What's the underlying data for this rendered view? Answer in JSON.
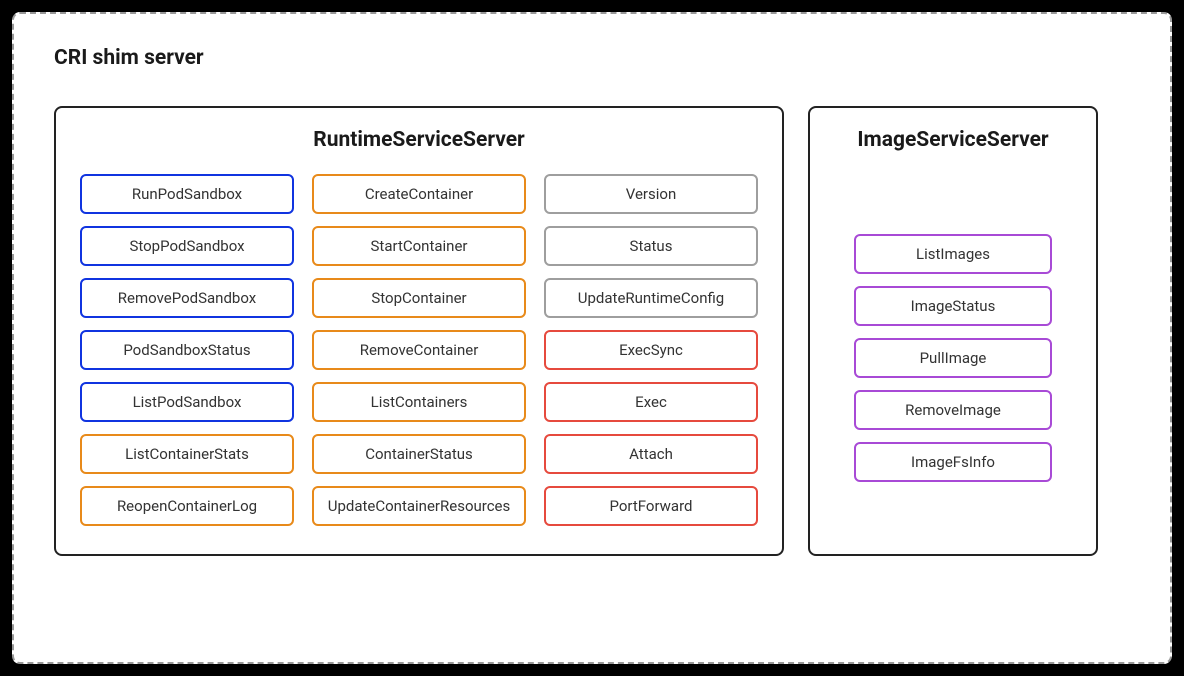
{
  "title": "CRI shim server",
  "colors": {
    "blue": "#1034e0",
    "orange": "#e88a1a",
    "gray": "#9e9e9e",
    "red": "#e64a3e",
    "purple": "#a84ad6"
  },
  "panels": {
    "runtime": {
      "title": "RuntimeServiceServer",
      "columns": [
        [
          {
            "label": "RunPodSandbox",
            "color": "blue"
          },
          {
            "label": "StopPodSandbox",
            "color": "blue"
          },
          {
            "label": "RemovePodSandbox",
            "color": "blue"
          },
          {
            "label": "PodSandboxStatus",
            "color": "blue"
          },
          {
            "label": "ListPodSandbox",
            "color": "blue"
          },
          {
            "label": "ListContainerStats",
            "color": "orange"
          },
          {
            "label": "ReopenContainerLog",
            "color": "orange"
          }
        ],
        [
          {
            "label": "CreateContainer",
            "color": "orange"
          },
          {
            "label": "StartContainer",
            "color": "orange"
          },
          {
            "label": "StopContainer",
            "color": "orange"
          },
          {
            "label": "RemoveContainer",
            "color": "orange"
          },
          {
            "label": "ListContainers",
            "color": "orange"
          },
          {
            "label": "ContainerStatus",
            "color": "orange"
          },
          {
            "label": "UpdateContainerResources",
            "color": "orange"
          }
        ],
        [
          {
            "label": "Version",
            "color": "gray"
          },
          {
            "label": "Status",
            "color": "gray"
          },
          {
            "label": "UpdateRuntimeConfig",
            "color": "gray"
          },
          {
            "label": "ExecSync",
            "color": "red"
          },
          {
            "label": "Exec",
            "color": "red"
          },
          {
            "label": "Attach",
            "color": "red"
          },
          {
            "label": "PortForward",
            "color": "red"
          }
        ]
      ]
    },
    "image": {
      "title": "ImageServiceServer",
      "items": [
        {
          "label": "ListImages",
          "color": "purple"
        },
        {
          "label": "ImageStatus",
          "color": "purple"
        },
        {
          "label": "PullImage",
          "color": "purple"
        },
        {
          "label": "RemoveImage",
          "color": "purple"
        },
        {
          "label": "ImageFsInfo",
          "color": "purple"
        }
      ]
    }
  }
}
